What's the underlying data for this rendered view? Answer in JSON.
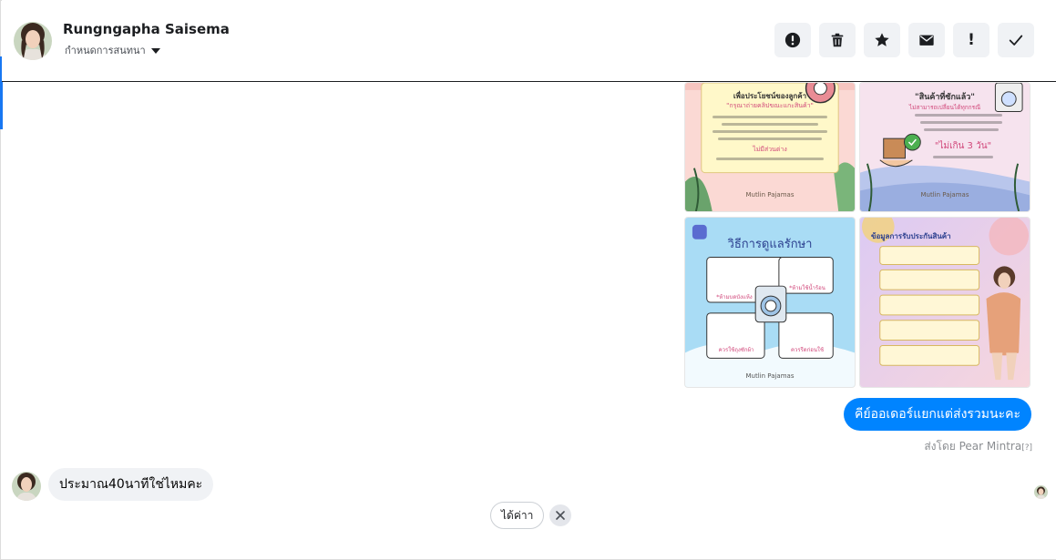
{
  "header": {
    "contact_name": "Rungngapha Saisema",
    "assign_label": "กำหนดการสนทนา",
    "toolbar": [
      {
        "name": "alert-button",
        "icon": "alert-circle-icon"
      },
      {
        "name": "delete-button",
        "icon": "trash-icon"
      },
      {
        "name": "star-button",
        "icon": "star-icon"
      },
      {
        "name": "mark-unread-button",
        "icon": "mail-icon"
      },
      {
        "name": "mark-spam-button",
        "icon": "exclamation-icon",
        "glyph": "!"
      },
      {
        "name": "mark-done-button",
        "icon": "checkmark-icon"
      }
    ]
  },
  "images": {
    "tile1": {
      "line1": "เพื่อประโยชน์ของลูกค้า",
      "line2": "\"กรุณาถ่ายคลิปขณะแกะสินค้า\"",
      "line3": "ไม่มีส่วนต่าง",
      "footer": "Mutlin Pajamas"
    },
    "tile2": {
      "line1": "\"สินค้าที่ซักแล้ว\"",
      "line2": "ไม่สามารถเปลี่ยนได้ทุกกรณี",
      "line3": "\"ไม่เกิน 3 วัน\"",
      "footer": "Mutlin Pajamas"
    },
    "tile3": {
      "line1": "วิธีการดูแลรักษา",
      "box1": "*ห้ามบดบังแห้ง",
      "box2": "*ห้ามใช้น้ำร้อน",
      "box3": "ควรใช้ถุงซักผ้า",
      "box4": "ควรรีดก่อนใช้",
      "footer": "Mutlin Pajamas"
    },
    "tile4": {
      "line1": "ข้อมูลการรับประกันสินค้า"
    }
  },
  "messages": {
    "outgoing": {
      "text": "คีย์ออเดอร์แยกแต่ส่งรวมนะคะ",
      "sent_by_prefix": "ส่งโดย",
      "sent_by_name": "Pear Mintra",
      "sent_by_help": "[?]",
      "bubble_color": "#0084ff"
    },
    "incoming": {
      "text": "ประมาณ40นาทีใช่ไหมคะ",
      "bubble_color": "#f0f2f5"
    }
  },
  "quick_reply": {
    "label": "ได้ค่าา"
  },
  "colors": {
    "accent": "#1877f2",
    "toolbar_button_bg": "#f0f2f5"
  }
}
